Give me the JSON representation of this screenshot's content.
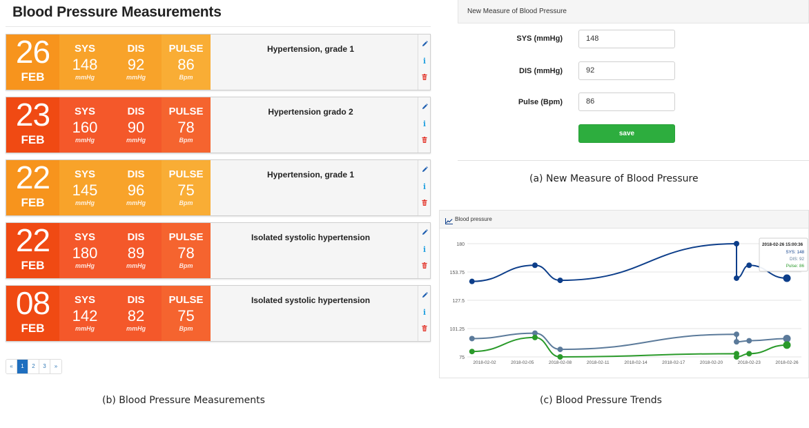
{
  "measurements": {
    "title": "Blood Pressure Measurements",
    "labels": {
      "sys": "SYS",
      "dis": "DIS",
      "pulse": "PULSE",
      "mmhg": "mmHg",
      "bpm": "Bpm"
    },
    "items": [
      {
        "day": "26",
        "month": "FEB",
        "sys": "148",
        "dis": "92",
        "pulse": "86",
        "diagnosis": "Hypertension, grade 1",
        "level": "orange"
      },
      {
        "day": "23",
        "month": "FEB",
        "sys": "160",
        "dis": "90",
        "pulse": "78",
        "diagnosis": "Hypertension grado 2",
        "level": "red"
      },
      {
        "day": "22",
        "month": "FEB",
        "sys": "145",
        "dis": "96",
        "pulse": "75",
        "diagnosis": "Hypertension, grade 1",
        "level": "orange"
      },
      {
        "day": "22",
        "month": "FEB",
        "sys": "180",
        "dis": "89",
        "pulse": "78",
        "diagnosis": "Isolated systolic hypertension",
        "level": "red"
      },
      {
        "day": "08",
        "month": "FEB",
        "sys": "142",
        "dis": "82",
        "pulse": "75",
        "diagnosis": "Isolated systolic hypertension",
        "level": "red"
      }
    ],
    "action_icons": [
      "pencil-icon",
      "info-icon",
      "trash-icon"
    ],
    "pagination": {
      "prev": "«",
      "pages": [
        "1",
        "2",
        "3"
      ],
      "next": "»",
      "active_page": "1"
    },
    "caption": "(b) Blood Pressure Measurements"
  },
  "form": {
    "header": "New Measure of Blood Pressure",
    "fields": [
      {
        "label": "SYS (mmHg)",
        "value": "148"
      },
      {
        "label": "DIS (mmHg)",
        "value": "92"
      },
      {
        "label": "Pulse (Bpm)",
        "value": "86"
      }
    ],
    "save_label": "save",
    "caption": "(a) New Measure of Blood Pressure"
  },
  "chart": {
    "header": "Blood pressure",
    "caption": "(c) Blood Pressure Trends",
    "tooltip": {
      "title": "2018-02-26 15:00:36",
      "sys": "SYS: 148",
      "dis": "DIS: 92",
      "pulse": "Pulse: 86"
    },
    "colors": {
      "sys": "#0d3e8a",
      "dis": "#5b7a9a",
      "pulse": "#2a9a2a",
      "grid": "#e3e3e3",
      "axis_text": "#555555",
      "header_icon": "#0d3e8a"
    }
  },
  "chart_data": {
    "type": "line",
    "title": "Blood pressure",
    "x_ticks": [
      "2018-02-02",
      "2018-02-05",
      "2018-02-08",
      "2018-02-11",
      "2018-02-14",
      "2018-02-17",
      "2018-02-20",
      "2018-02-23",
      "2018-02-26"
    ],
    "y_ticks": [
      "75",
      "101.25",
      "127.5",
      "153.75",
      "180"
    ],
    "ylim": [
      75,
      180
    ],
    "grid": "horizontal",
    "series": [
      {
        "key": "sys",
        "x": [
          "2018-02-01",
          "2018-02-06",
          "2018-02-08",
          "2018-02-22",
          "2018-02-22",
          "2018-02-23",
          "2018-02-26"
        ],
        "values": [
          145,
          160,
          146,
          180,
          148,
          160,
          148
        ]
      },
      {
        "key": "dis",
        "x": [
          "2018-02-01",
          "2018-02-06",
          "2018-02-08",
          "2018-02-22",
          "2018-02-22",
          "2018-02-23",
          "2018-02-26"
        ],
        "values": [
          92,
          97,
          82,
          96,
          89,
          90,
          92
        ]
      },
      {
        "key": "pulse",
        "x": [
          "2018-02-01",
          "2018-02-06",
          "2018-02-08",
          "2018-02-22",
          "2018-02-22",
          "2018-02-23",
          "2018-02-26"
        ],
        "values": [
          80,
          93,
          75,
          78,
          75,
          78,
          86
        ]
      }
    ],
    "tooltip_position": "top-right"
  }
}
